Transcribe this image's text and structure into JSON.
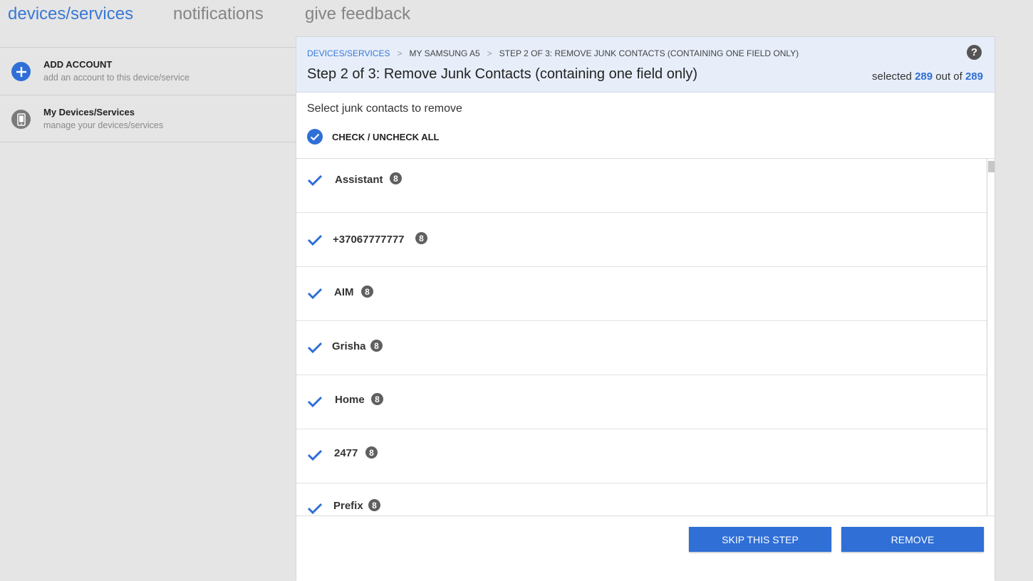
{
  "nav": {
    "tabs": [
      {
        "label": "devices/services",
        "active": true
      },
      {
        "label": "notifications",
        "active": false
      },
      {
        "label": "give feedback",
        "active": false
      }
    ]
  },
  "sidebar": {
    "items": [
      {
        "title": "ADD ACCOUNT",
        "subtitle": "add an account to this device/service",
        "icon": "plus-icon"
      },
      {
        "title": "My Devices/Services",
        "subtitle": "manage your devices/services",
        "icon": "phone-icon"
      }
    ]
  },
  "panel": {
    "breadcrumb": {
      "link": "DEVICES/SERVICES",
      "sep": ">",
      "device": "MY SAMSUNG A5",
      "current": "STEP 2 OF 3: REMOVE JUNK CONTACTS (CONTAINING ONE FIELD ONLY)"
    },
    "title": "Step 2 of 3: Remove Junk Contacts (containing one field only)",
    "help_icon": "?",
    "selected": {
      "prefix": "selected",
      "count": "289",
      "middle": "out of",
      "total": "289"
    },
    "select_label": "Select junk contacts to remove",
    "check_all_label": "CHECK / UNCHECK ALL",
    "contacts": [
      {
        "name": "Assistant",
        "source_icon": "google-icon",
        "checked": true
      },
      {
        "name": "+37067777777",
        "source_icon": "google-icon",
        "checked": true
      },
      {
        "name": "AIM",
        "source_icon": "google-icon",
        "checked": true
      },
      {
        "name": "Grisha",
        "source_icon": "google-icon",
        "checked": true
      },
      {
        "name": "Home",
        "source_icon": "google-icon",
        "checked": true
      },
      {
        "name": "2477",
        "source_icon": "google-icon",
        "checked": true
      },
      {
        "name": "Prefix",
        "source_icon": "google-icon",
        "checked": true
      }
    ],
    "source_glyph": "8",
    "buttons": {
      "skip": "SKIP THIS STEP",
      "remove": "REMOVE"
    }
  },
  "colors": {
    "accent": "#2f6fd6",
    "active_tab": "#3a78d6",
    "header_bg": "#e7eefa"
  }
}
